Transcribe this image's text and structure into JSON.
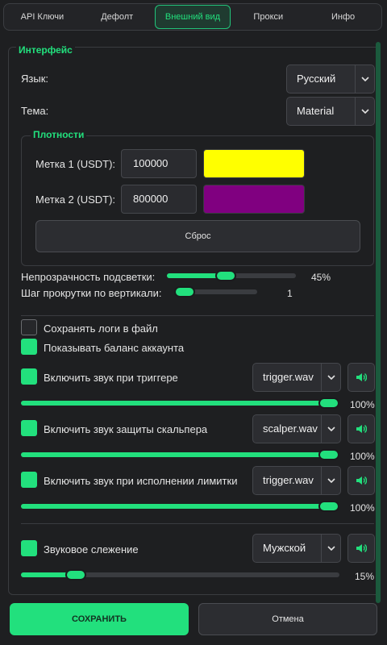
{
  "tabs": [
    {
      "label": "API Ключи"
    },
    {
      "label": "Дефолт"
    },
    {
      "label": "Внешний вид",
      "active": true
    },
    {
      "label": "Прокси"
    },
    {
      "label": "Инфо"
    }
  ],
  "interface": {
    "legend": "Интерфейс",
    "language_label": "Язык:",
    "language_value": "Русский",
    "theme_label": "Тема:",
    "theme_value": "Material"
  },
  "densities": {
    "legend": "Плотности",
    "mark1_label": "Метка 1 (USDT):",
    "mark1_value": "100000",
    "mark1_color": "#ffff00",
    "mark2_label": "Метка 2 (USDT):",
    "mark2_value": "800000",
    "mark2_color": "#800080",
    "reset_label": "Сброс"
  },
  "sliders": {
    "opacity_label": "Непрозрачность подсветки:",
    "opacity_value": "45%",
    "opacity_fraction": 0.45,
    "scroll_label": "Шаг прокрутки по вертикали:",
    "scroll_value": "1"
  },
  "options": {
    "save_logs": {
      "label": "Сохранять логи в файл",
      "checked": false
    },
    "show_balance": {
      "label": "Показывать баланс аккаунта",
      "checked": true
    }
  },
  "sounds": [
    {
      "label": "Включить звук при триггере",
      "file": "trigger.wav",
      "volume": "100%",
      "checked": true
    },
    {
      "label": "Включить звук защиты скальпера",
      "file": "scalper.wav",
      "volume": "100%",
      "checked": true
    },
    {
      "label": "Включить звук при исполнении лимитки",
      "file": "trigger.wav",
      "volume": "100%",
      "checked": true
    }
  ],
  "voice": {
    "label": "Звуковое слежение",
    "value": "Мужской",
    "volume": "15%",
    "checked": true
  },
  "footer": {
    "save_label": "СОХРАНИТЬ",
    "cancel_label": "Отмена"
  },
  "colors": {
    "accent": "#22e07d",
    "background": "#1e1f21"
  }
}
